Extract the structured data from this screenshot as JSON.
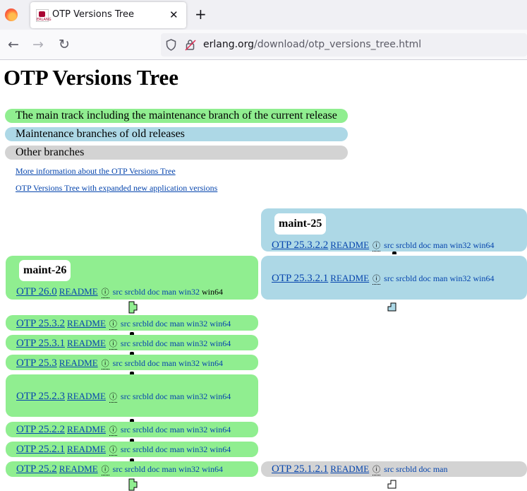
{
  "browser": {
    "tab_title": "OTP Versions Tree",
    "tab_favicon_text": "ERLANG",
    "close_glyph": "✕",
    "newtab_glyph": "+",
    "back_glyph": "←",
    "forward_glyph": "→",
    "reload_glyph": "↻",
    "url_host": "erlang.org",
    "url_path": "/download/otp_versions_tree.html"
  },
  "page": {
    "title": "OTP Versions Tree",
    "legend": [
      "The main track including the maintenance branch of the current release",
      "Maintenance branches of old releases",
      "Other branches"
    ],
    "links": [
      "More information about the OTP Versions Tree",
      "OTP Versions Tree with expanded new application versions"
    ]
  },
  "branches": {
    "left": "maint-26",
    "right": "maint-25"
  },
  "versions": {
    "v2532": "OTP 25.3.2.2",
    "v2531r": "OTP 25.3.2.1",
    "v260": "OTP 26.0",
    "v2532b": "OTP 25.3.2",
    "v2531": "OTP 25.3.1",
    "v253": "OTP 25.3",
    "v2523": "OTP 25.2.3",
    "v2522": "OTP 25.2.2",
    "v2521": "OTP 25.2.1",
    "v252": "OTP 25.2",
    "v25121": "OTP 25.1.2.1"
  },
  "labels": {
    "readme": "README",
    "info": "ⓘ",
    "src": "src",
    "srcbld": "srcbld",
    "doc": "doc",
    "man": "man",
    "win32": "win32",
    "win64": "win64"
  },
  "colors": {
    "main": "#90ee90",
    "maint": "#add8e6",
    "other": "#d3d3d3",
    "link": "#0645ad"
  }
}
